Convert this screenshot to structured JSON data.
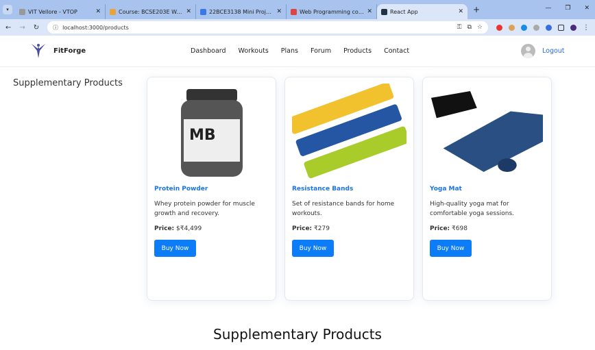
{
  "browser": {
    "tabs": [
      {
        "title": "VIT Vellore - VTOP",
        "color": "#999"
      },
      {
        "title": "Course: BCSE203E Web Progra...",
        "color": "#e8a33a"
      },
      {
        "title": "22BCE3138 Mini Project Repor...",
        "color": "#3b78e7"
      },
      {
        "title": "Web Programming course(BC...",
        "color": "#d44"
      },
      {
        "title": "React App",
        "color": "#234"
      }
    ],
    "url": "localhost:3000/products"
  },
  "nav": {
    "brand": "FitForge",
    "links": [
      "Dashboard",
      "Workouts",
      "Plans",
      "Forum",
      "Products",
      "Contact"
    ],
    "logout": "Logout"
  },
  "sidebar_title": "Supplementary Products",
  "products": [
    {
      "name": "Protein Powder",
      "desc": "Whey protein powder for muscle growth and recovery.",
      "price_label": "Price:",
      "price": "$₹4,499",
      "button": "Buy Now"
    },
    {
      "name": "Resistance Bands",
      "desc": "Set of resistance bands for home workouts.",
      "price_label": "Price:",
      "price": "₹279",
      "button": "Buy Now"
    },
    {
      "name": "Yoga Mat",
      "desc": "High-quality yoga mat for comfortable yoga sessions.",
      "price_label": "Price:",
      "price": "₹698",
      "button": "Buy Now"
    }
  ],
  "footer_title": "Supplementary Products",
  "colors": {
    "accent": "#0d7cf7",
    "link": "#1a73e8"
  }
}
